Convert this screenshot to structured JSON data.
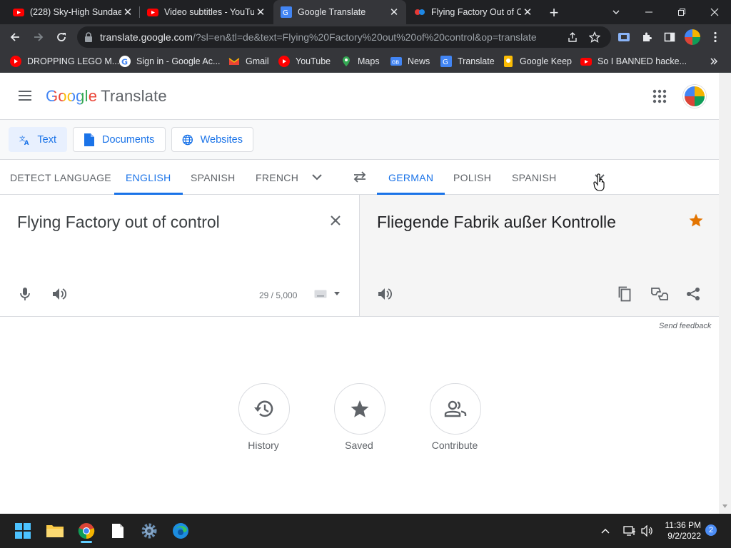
{
  "browser": {
    "tabs": [
      {
        "title": "(228) Sky-High Sundae",
        "favicon": "youtube-icon"
      },
      {
        "title": "Video subtitles - YouTu",
        "favicon": "youtube-icon"
      },
      {
        "title": "Google Translate",
        "favicon": "google-translate-icon",
        "active": true
      },
      {
        "title": "Flying Factory Out of C",
        "favicon": "lego-icon"
      }
    ],
    "url_host": "translate.google.com",
    "url_rest": "/?sl=en&tl=de&text=Flying%20Factory%20out%20of%20control&op=translate",
    "bookmarks": [
      {
        "label": "DROPPING LEGO M...",
        "favicon": "youtube-icon"
      },
      {
        "label": "Sign in - Google Ac...",
        "favicon": "google-icon"
      },
      {
        "label": "Gmail",
        "favicon": "gmail-icon"
      },
      {
        "label": "YouTube",
        "favicon": "youtube-icon"
      },
      {
        "label": "Maps",
        "favicon": "maps-icon"
      },
      {
        "label": "News",
        "favicon": "news-icon"
      },
      {
        "label": "Translate",
        "favicon": "google-translate-icon"
      },
      {
        "label": "Google Keep",
        "favicon": "keep-icon"
      },
      {
        "label": "So I BANNED hacke...",
        "favicon": "youtube-icon"
      }
    ]
  },
  "header": {
    "logo_google": "Google",
    "logo_product": "Translate"
  },
  "modes": {
    "text": "Text",
    "documents": "Documents",
    "websites": "Websites"
  },
  "source_langs": [
    "DETECT LANGUAGE",
    "ENGLISH",
    "SPANISH",
    "FRENCH"
  ],
  "target_langs": [
    "GERMAN",
    "POLISH",
    "SPANISH"
  ],
  "source": {
    "text": "Flying Factory out of control",
    "count": "29 / 5,000"
  },
  "target": {
    "text": "Fliegende Fabrik außer Kontrolle"
  },
  "feedback": "Send feedback",
  "actions": {
    "history": "History",
    "saved": "Saved",
    "contribute": "Contribute"
  },
  "taskbar": {
    "time": "11:36 PM",
    "date": "9/2/2022",
    "notifications": "2"
  },
  "colors": {
    "accent": "#1a73e8",
    "star": "#e37400"
  }
}
